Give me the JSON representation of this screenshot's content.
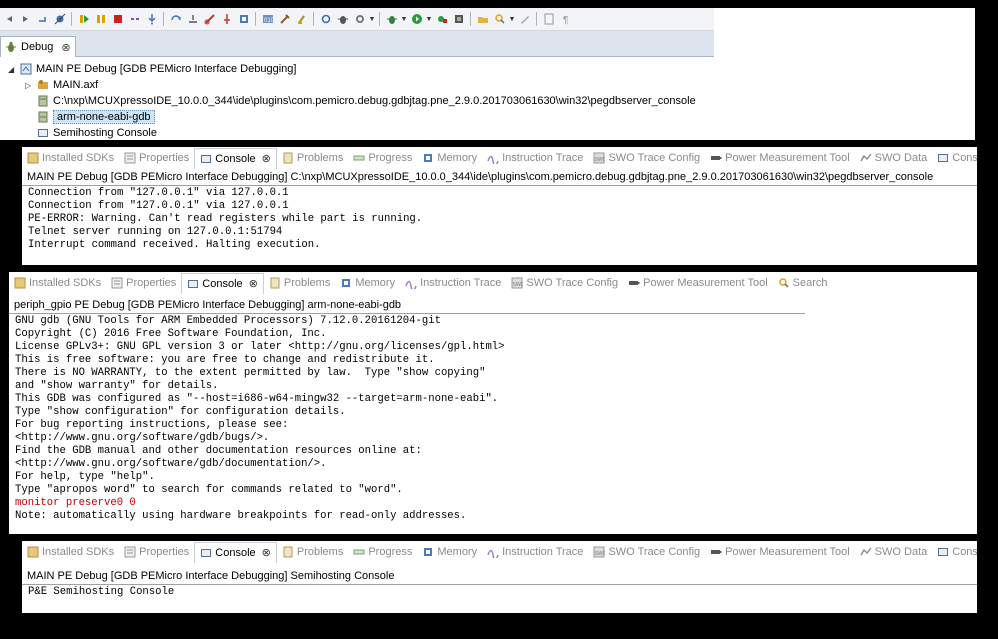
{
  "toolbar": {
    "icons": [
      "back-icon",
      "forward-icon",
      "step-return-icon",
      "skip-breakpoints-icon",
      "resume-icon",
      "suspend-icon",
      "terminate-icon",
      "disconnect-icon",
      "step-into-icon",
      "step-over-icon",
      "drop-to-frame-icon",
      "connect-icon",
      "pin-icon",
      "memory-icon",
      "registers-icon",
      "build-icon",
      "clean-icon",
      "debug-settings-icon",
      "bug-icon",
      "gear-icon",
      "debug-icon",
      "run-icon",
      "external-tools-icon",
      "open-type-icon",
      "open-folder-icon",
      "search-icon",
      "edit-icon",
      "annotation-icon",
      "paragraph-icon"
    ]
  },
  "debug_view": {
    "tab_label": "Debug",
    "tree": [
      {
        "label": "MAIN PE Debug [GDB PEMicro Interface Debugging]",
        "level": 0,
        "icon": "launch-icon"
      },
      {
        "label": "MAIN.axf",
        "level": 1,
        "icon": "process-icon"
      },
      {
        "label": "C:\\nxp\\MCUXpressoIDE_10.0.0_344\\ide\\plugins\\com.pemicro.debug.gdbjtag.pne_2.9.0.201703061630\\win32\\pegdbserver_console",
        "level": 1,
        "icon": "server-icon"
      },
      {
        "label": "arm-none-eabi-gdb",
        "level": 1,
        "icon": "gdb-icon",
        "selected": true
      },
      {
        "label": "Semihosting Console",
        "level": 1,
        "icon": "console-icon"
      }
    ]
  },
  "console1": {
    "tabs": [
      {
        "label": "Installed SDKs",
        "icon": "sdk-icon"
      },
      {
        "label": "Properties",
        "icon": "properties-icon"
      },
      {
        "label": "Console",
        "icon": "console-icon",
        "active": true
      },
      {
        "label": "Problems",
        "icon": "problems-icon"
      },
      {
        "label": "Progress",
        "icon": "progress-icon"
      },
      {
        "label": "Memory",
        "icon": "memory-icon"
      },
      {
        "label": "Instruction Trace",
        "icon": "instruction-trace-icon"
      },
      {
        "label": "SWO Trace Config",
        "icon": "swo-icon"
      },
      {
        "label": "Power Measurement Tool",
        "icon": "power-icon"
      },
      {
        "label": "SWO Data",
        "icon": "swo-data-icon"
      },
      {
        "label": "Console",
        "icon": "console-icon"
      }
    ],
    "title": "MAIN PE Debug [GDB PEMicro Interface Debugging] C:\\nxp\\MCUXpressoIDE_10.0.0_344\\ide\\plugins\\com.pemicro.debug.gdbjtag.pne_2.9.0.201703061630\\win32\\pegdbserver_console",
    "lines": [
      "Connection from \"127.0.0.1\" via 127.0.0.1",
      "Connection from \"127.0.0.1\" via 127.0.0.1",
      "PE-ERROR: Warning. Can't read registers while part is running.",
      "Telnet server running on 127.0.0.1:51794",
      "Interrupt command received. Halting execution."
    ]
  },
  "console2": {
    "tabs": [
      {
        "label": "Installed SDKs",
        "icon": "sdk-icon"
      },
      {
        "label": "Properties",
        "icon": "properties-icon"
      },
      {
        "label": "Console",
        "icon": "console-icon",
        "active": true
      },
      {
        "label": "Problems",
        "icon": "problems-icon"
      },
      {
        "label": "Memory",
        "icon": "memory-icon"
      },
      {
        "label": "Instruction Trace",
        "icon": "instruction-trace-icon"
      },
      {
        "label": "SWO Trace Config",
        "icon": "swo-icon"
      },
      {
        "label": "Power Measurement Tool",
        "icon": "power-icon"
      },
      {
        "label": "Search",
        "icon": "search-icon"
      }
    ],
    "title": "periph_gpio PE Debug [GDB PEMicro Interface Debugging] arm-none-eabi-gdb",
    "lines": [
      "GNU gdb (GNU Tools for ARM Embedded Processors) 7.12.0.20161204-git",
      "Copyright (C) 2016 Free Software Foundation, Inc.",
      "License GPLv3+: GNU GPL version 3 or later <http://gnu.org/licenses/gpl.html>",
      "This is free software: you are free to change and redistribute it.",
      "There is NO WARRANTY, to the extent permitted by law.  Type \"show copying\"",
      "and \"show warranty\" for details.",
      "This GDB was configured as \"--host=i686-w64-mingw32 --target=arm-none-eabi\".",
      "Type \"show configuration\" for configuration details.",
      "For bug reporting instructions, please see:",
      "<http://www.gnu.org/software/gdb/bugs/>.",
      "Find the GDB manual and other documentation resources online at:",
      "<http://www.gnu.org/software/gdb/documentation/>.",
      "For help, type \"help\".",
      "Type \"apropos word\" to search for commands related to \"word\".",
      "monitor preserve0 0",
      "Note: automatically using hardware breakpoints for read-only addresses."
    ],
    "red_line_index": 14
  },
  "console3": {
    "tabs": [
      {
        "label": "Installed SDKs",
        "icon": "sdk-icon"
      },
      {
        "label": "Properties",
        "icon": "properties-icon"
      },
      {
        "label": "Console",
        "icon": "console-icon",
        "active": true
      },
      {
        "label": "Problems",
        "icon": "problems-icon"
      },
      {
        "label": "Progress",
        "icon": "progress-icon"
      },
      {
        "label": "Memory",
        "icon": "memory-icon"
      },
      {
        "label": "Instruction Trace",
        "icon": "instruction-trace-icon"
      },
      {
        "label": "SWO Trace Config",
        "icon": "swo-icon"
      },
      {
        "label": "Power Measurement Tool",
        "icon": "power-icon"
      },
      {
        "label": "SWO Data",
        "icon": "swo-data-icon"
      },
      {
        "label": "Console",
        "icon": "console-icon"
      }
    ],
    "title": "MAIN PE Debug [GDB PEMicro Interface Debugging] Semihosting Console",
    "lines": [
      "P&E Semihosting Console"
    ]
  },
  "colors": {
    "background": "#000000",
    "error_text": "#c00000",
    "selection": "#cde3f7"
  }
}
